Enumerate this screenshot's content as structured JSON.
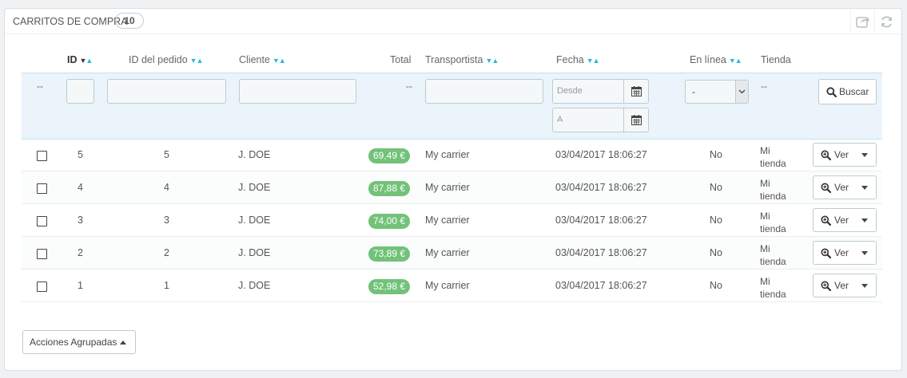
{
  "panel": {
    "title": "CARRITOS DE COMPRA",
    "count": "10",
    "tools": [
      "export-icon",
      "refresh-icon"
    ]
  },
  "columns": {
    "id": "ID",
    "order_id": "ID del pedido",
    "customer": "Cliente",
    "total": "Total",
    "carrier": "Transportista",
    "date": "Fecha",
    "online": "En línea",
    "store": "Tienda"
  },
  "filters": {
    "empty_marker": "--",
    "date_from_placeholder": "Desde",
    "date_to_placeholder": "A",
    "online_selected": "-",
    "search_label": "Buscar"
  },
  "rows": [
    {
      "id": "5",
      "order_id": "5",
      "customer": "J. DOE",
      "total": "69,49 €",
      "carrier": "My carrier",
      "date": "03/04/2017 18:06:27",
      "online": "No",
      "store_line1": "Mi",
      "store_line2": "tienda",
      "action": "Ver"
    },
    {
      "id": "4",
      "order_id": "4",
      "customer": "J. DOE",
      "total": "87,88 €",
      "carrier": "My carrier",
      "date": "03/04/2017 18:06:27",
      "online": "No",
      "store_line1": "Mi",
      "store_line2": "tienda",
      "action": "Ver"
    },
    {
      "id": "3",
      "order_id": "3",
      "customer": "J. DOE",
      "total": "74,00 €",
      "carrier": "My carrier",
      "date": "03/04/2017 18:06:27",
      "online": "No",
      "store_line1": "Mi",
      "store_line2": "tienda",
      "action": "Ver"
    },
    {
      "id": "2",
      "order_id": "2",
      "customer": "J. DOE",
      "total": "73,89 €",
      "carrier": "My carrier",
      "date": "03/04/2017 18:06:27",
      "online": "No",
      "store_line1": "Mi",
      "store_line2": "tienda",
      "action": "Ver"
    },
    {
      "id": "1",
      "order_id": "1",
      "customer": "J. DOE",
      "total": "52,98 €",
      "carrier": "My carrier",
      "date": "03/04/2017 18:06:27",
      "online": "No",
      "store_line1": "Mi",
      "store_line2": "tienda",
      "action": "Ver"
    }
  ],
  "bulk_actions": "Acciones Agrupadas",
  "colors": {
    "accent": "#25b9d7",
    "price_badge": "#72c279",
    "filter_band": "#ebf4fb"
  }
}
